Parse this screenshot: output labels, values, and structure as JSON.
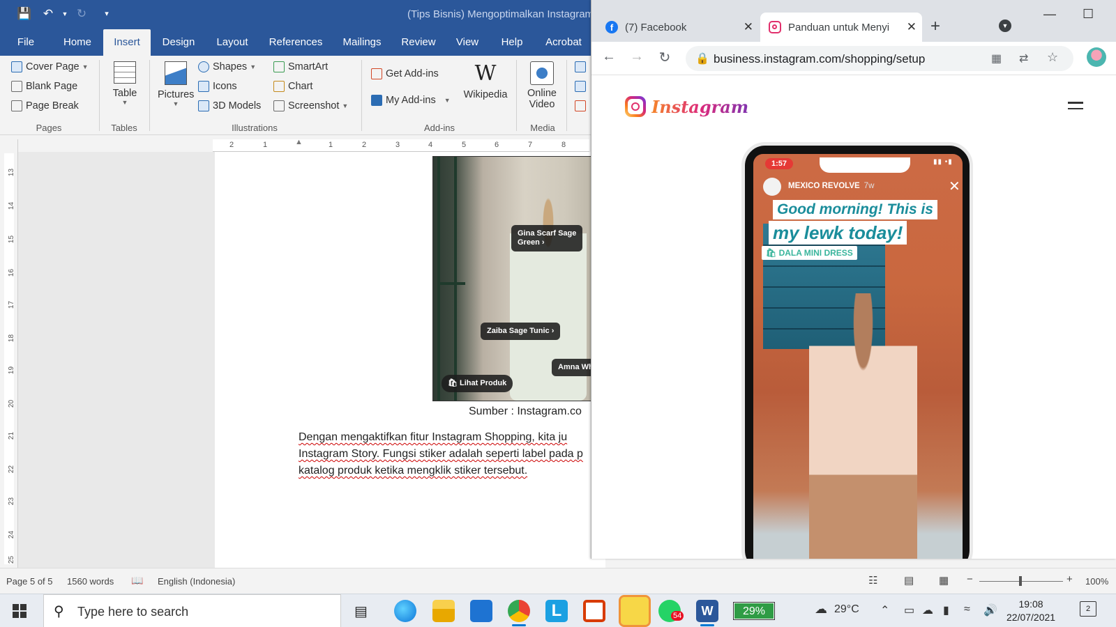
{
  "word": {
    "document_title": "(Tips Bisnis) Mengoptimalkan Instagram",
    "tabs": [
      "File",
      "Home",
      "Insert",
      "Design",
      "Layout",
      "References",
      "Mailings",
      "Review",
      "View",
      "Help",
      "Acrobat"
    ],
    "active_tab": "Insert",
    "ribbon": {
      "pages": {
        "label": "Pages",
        "cover_page": "Cover Page",
        "blank_page": "Blank Page",
        "page_break": "Page Break"
      },
      "tables": {
        "label": "Tables",
        "table": "Table"
      },
      "illustrations": {
        "label": "Illustrations",
        "pictures": "Pictures",
        "shapes": "Shapes",
        "icons": "Icons",
        "models_3d": "3D Models",
        "smartart": "SmartArt",
        "chart": "Chart",
        "screenshot": "Screenshot"
      },
      "addins": {
        "label": "Add-ins",
        "get_addins": "Get Add-ins",
        "my_addins": "My Add-ins",
        "wikipedia": "Wikipedia"
      },
      "media": {
        "label": "Media",
        "online_video_1": "Online",
        "online_video_2": "Video"
      }
    },
    "ruler_numbers": [
      "2",
      "1",
      "1",
      "2",
      "3",
      "4",
      "5",
      "6",
      "7",
      "8"
    ],
    "vruler_numbers": [
      "13",
      "14",
      "15",
      "16",
      "17",
      "18",
      "19",
      "20",
      "21",
      "22",
      "23",
      "24",
      "25"
    ],
    "document": {
      "image_tags": [
        "Gina Scarf Sage",
        "Green",
        "Zaiba Sage Tunic",
        "Amna Wh",
        "Lihat Produk"
      ],
      "caption": "Sumber : Instagram.co",
      "paragraph_lines": [
        "Dengan mengaktifkan fitur Instagram Shopping, kita ju",
        "Instagram Story. Fungsi stiker adalah seperti label pada p",
        "katalog produk ketika mengklik stiker tersebut."
      ]
    },
    "status": {
      "page": "Page 5 of 5",
      "words": "1560 words",
      "language": "English (Indonesia)",
      "zoom": "100%"
    }
  },
  "chrome": {
    "tabs": [
      {
        "title": "(7) Facebook",
        "favicon": "facebook-icon"
      },
      {
        "title": "Panduan untuk Menyi",
        "favicon": "instagram-icon"
      }
    ],
    "url": "business.instagram.com/shopping/setup",
    "page": {
      "logo_text": "Instagram",
      "phone_time": "1:57",
      "story_account": "MEXICO REVOLVE",
      "story_age": "7w",
      "story_line_1": "Good morning! This is",
      "story_line_2": "my lewk today!",
      "sticker": "DALA MINI DRESS"
    }
  },
  "taskbar": {
    "search_placeholder": "Type here to search",
    "whatsapp_badge": "54",
    "battery": "29%",
    "temperature": "29°C",
    "time": "19:08",
    "date": "22/07/2021",
    "notifications": "2"
  }
}
